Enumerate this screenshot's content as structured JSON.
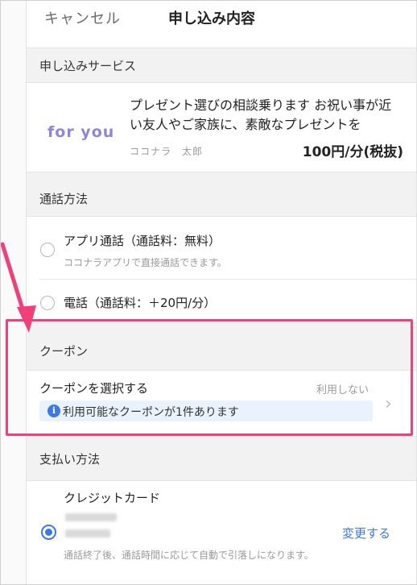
{
  "header": {
    "cancel_label": "キャンセル",
    "title": "申し込み内容"
  },
  "service_section": {
    "heading": "申し込みサービス",
    "logo_text": "for you",
    "description": "プレゼント選びの相談乗ります お祝い事が近い友人やご家族に、素敵なプレゼントを",
    "seller": "ココナラ　太郎",
    "price": "100円/分(税抜)"
  },
  "call_method_section": {
    "heading": "通話方法",
    "options": [
      {
        "label": "アプリ通話（通話料：無料）",
        "sub": "ココナラアプリで直接通話できます。",
        "selected": false
      },
      {
        "label": "電話（通話料：＋20円/分）",
        "sub": "",
        "selected": false
      }
    ]
  },
  "coupon_section": {
    "heading": "クーポン",
    "select_label": "クーポンを選択する",
    "status": "利用しない",
    "notice": "利用可能なクーポンが1件あります",
    "highlight_color": "#f0407a"
  },
  "payment_section": {
    "heading": "支払い方法",
    "method_label": "クレジットカード",
    "change_label": "変更する",
    "note": "通話終了後、通話時間に応じて自動で引落しになります。",
    "selected": true
  },
  "colors": {
    "accent": "#3b79e6",
    "section_bg": "#f2f2f2",
    "annotation": "#f0407a"
  }
}
